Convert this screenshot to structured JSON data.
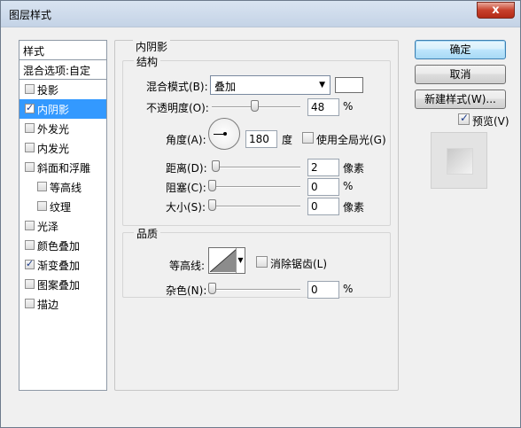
{
  "window": {
    "title": "图层样式",
    "close_glyph": "x"
  },
  "styles_list": {
    "header": "样式",
    "blending_options": "混合选项:自定",
    "items": [
      {
        "label": "投影",
        "checked": false,
        "indent": false,
        "selected": false
      },
      {
        "label": "内阴影",
        "checked": true,
        "indent": false,
        "selected": true
      },
      {
        "label": "外发光",
        "checked": false,
        "indent": false,
        "selected": false
      },
      {
        "label": "内发光",
        "checked": false,
        "indent": false,
        "selected": false
      },
      {
        "label": "斜面和浮雕",
        "checked": false,
        "indent": false,
        "selected": false
      },
      {
        "label": "等高线",
        "checked": false,
        "indent": true,
        "selected": false
      },
      {
        "label": "纹理",
        "checked": false,
        "indent": true,
        "selected": false
      },
      {
        "label": "光泽",
        "checked": false,
        "indent": false,
        "selected": false
      },
      {
        "label": "颜色叠加",
        "checked": false,
        "indent": false,
        "selected": false
      },
      {
        "label": "渐变叠加",
        "checked": true,
        "indent": false,
        "selected": false
      },
      {
        "label": "图案叠加",
        "checked": false,
        "indent": false,
        "selected": false
      },
      {
        "label": "描边",
        "checked": false,
        "indent": false,
        "selected": false
      }
    ]
  },
  "inner_shadow": {
    "panel_title": "内阴影",
    "structure": {
      "title": "结构",
      "blend_mode_label": "混合模式(B):",
      "blend_mode_value": "叠加",
      "blend_color": "#ffffff",
      "opacity_label": "不透明度(O):",
      "opacity_value": "48",
      "opacity_unit": "%",
      "opacity_fraction": 0.48,
      "angle_label": "角度(A):",
      "angle_value": "180",
      "angle_unit": "度",
      "global_light_label": "使用全局光(G)",
      "global_light_checked": false,
      "distance_label": "距离(D):",
      "distance_value": "2",
      "distance_unit": "像素",
      "choke_label": "阻塞(C):",
      "choke_value": "0",
      "choke_unit": "%",
      "size_label": "大小(S):",
      "size_value": "0",
      "size_unit": "像素"
    },
    "quality": {
      "title": "品质",
      "contour_label": "等高线:",
      "anti_alias_label": "消除锯齿(L)",
      "anti_alias_checked": false,
      "noise_label": "杂色(N):",
      "noise_value": "0",
      "noise_unit": "%"
    }
  },
  "actions": {
    "ok": "确定",
    "cancel": "取消",
    "new_style": "新建样式(W)...",
    "preview_label": "预览(V)",
    "preview_checked": true
  }
}
